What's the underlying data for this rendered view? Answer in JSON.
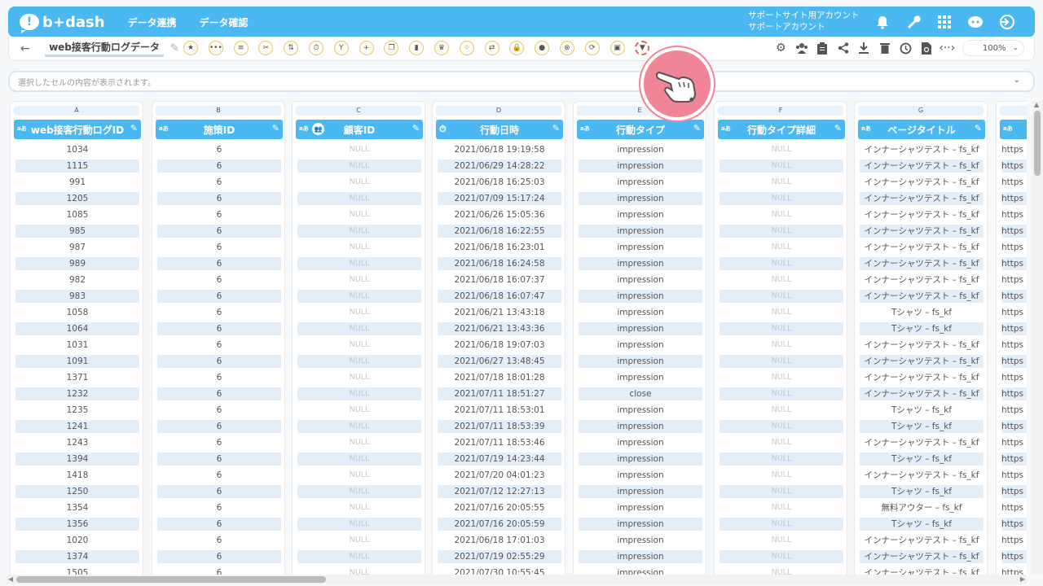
{
  "header": {
    "logo_text": "b+dash",
    "nav": [
      "データ連携",
      "データ確認"
    ],
    "account_line1": "サポートサイト用アカウント",
    "account_line2": "サポートアカウント"
  },
  "toolbar": {
    "back": "←",
    "table_name": "web接客行動ログデータ",
    "zoom": "100%",
    "buttons": [
      "★",
      "•••",
      "≡",
      "✂",
      "⇅",
      "⏱",
      "Y",
      "+",
      "❐",
      "▮",
      "♛",
      "⁘",
      "⇄",
      "🔒",
      "●",
      "⊗",
      "⟳",
      "▣",
      "▼"
    ]
  },
  "cellbar": {
    "placeholder": "選択したセルの内容が表示されます。"
  },
  "columns": [
    {
      "letter": "A",
      "title": "web接客行動ログID"
    },
    {
      "letter": "B",
      "title": "施策ID"
    },
    {
      "letter": "C",
      "title": "顧客ID"
    },
    {
      "letter": "D",
      "title": "行動日時"
    },
    {
      "letter": "E",
      "title": "行動タイプ"
    },
    {
      "letter": "F",
      "title": "行動タイプ詳細"
    },
    {
      "letter": "G",
      "title": "ページタイトル"
    },
    {
      "letter": "H",
      "title": ""
    }
  ],
  "type_tag": "aあ",
  "null_text": "NULL",
  "url_prefix": "https",
  "rows": [
    [
      "1034",
      "6",
      "2021/06/18 19:19:58",
      "impression",
      "インナーシャツテスト – fs_kf"
    ],
    [
      "1115",
      "6",
      "2021/06/29 14:28:22",
      "impression",
      "インナーシャツテスト – fs_kf"
    ],
    [
      "991",
      "6",
      "2021/06/18 16:25:03",
      "impression",
      "インナーシャツテスト – fs_kf"
    ],
    [
      "1205",
      "6",
      "2021/07/09 15:17:24",
      "impression",
      "インナーシャツテスト – fs_kf"
    ],
    [
      "1085",
      "6",
      "2021/06/26 15:05:36",
      "impression",
      "インナーシャツテスト – fs_kf"
    ],
    [
      "985",
      "6",
      "2021/06/18 16:22:55",
      "impression",
      "インナーシャツテスト – fs_kf"
    ],
    [
      "987",
      "6",
      "2021/06/18 16:23:01",
      "impression",
      "インナーシャツテスト – fs_kf"
    ],
    [
      "989",
      "6",
      "2021/06/18 16:24:58",
      "impression",
      "インナーシャツテスト – fs_kf"
    ],
    [
      "982",
      "6",
      "2021/06/18 16:07:37",
      "impression",
      "インナーシャツテスト – fs_kf"
    ],
    [
      "983",
      "6",
      "2021/06/18 16:07:47",
      "impression",
      "インナーシャツテスト – fs_kf"
    ],
    [
      "1058",
      "6",
      "2021/06/21 13:43:18",
      "impression",
      "Tシャツ – fs_kf"
    ],
    [
      "1064",
      "6",
      "2021/06/21 13:43:36",
      "impression",
      "Tシャツ – fs_kf"
    ],
    [
      "1031",
      "6",
      "2021/06/18 19:07:03",
      "impression",
      "インナーシャツテスト – fs_kf"
    ],
    [
      "1091",
      "6",
      "2021/06/27 13:48:45",
      "impression",
      "インナーシャツテスト – fs_kf"
    ],
    [
      "1371",
      "6",
      "2021/07/18 18:01:28",
      "impression",
      "インナーシャツテスト – fs_kf"
    ],
    [
      "1232",
      "6",
      "2021/07/11 18:51:27",
      "close",
      "インナーシャツテスト – fs_kf"
    ],
    [
      "1235",
      "6",
      "2021/07/11 18:53:01",
      "impression",
      "Tシャツ – fs_kf"
    ],
    [
      "1241",
      "6",
      "2021/07/11 18:53:39",
      "impression",
      "Tシャツ – fs_kf"
    ],
    [
      "1243",
      "6",
      "2021/07/11 18:53:46",
      "impression",
      "インナーシャツテスト – fs_kf"
    ],
    [
      "1394",
      "6",
      "2021/07/19 14:23:44",
      "impression",
      "Tシャツ – fs_kf"
    ],
    [
      "1418",
      "6",
      "2021/07/20 04:01:23",
      "impression",
      "インナーシャツテスト – fs_kf"
    ],
    [
      "1250",
      "6",
      "2021/07/12 12:27:13",
      "impression",
      "Tシャツ – fs_kf"
    ],
    [
      "1354",
      "6",
      "2021/07/16 20:05:55",
      "impression",
      "無料アウター – fs_kf"
    ],
    [
      "1356",
      "6",
      "2021/07/16 20:05:59",
      "impression",
      "Tシャツ – fs_kf"
    ],
    [
      "1020",
      "6",
      "2021/06/18 17:01:03",
      "impression",
      "インナーシャツテスト – fs_kf"
    ],
    [
      "1374",
      "6",
      "2021/07/19 02:55:29",
      "impression",
      "インナーシャツテスト – fs_kf"
    ],
    [
      "1505",
      "6",
      "2021/07/30 10:55:45",
      "impression",
      "インナーシャツテスト – fs_kf"
    ]
  ],
  "colors": {
    "accent": "#4cb8f1",
    "alt_row": "#e3eef8",
    "highlight": "#e85b6d"
  }
}
